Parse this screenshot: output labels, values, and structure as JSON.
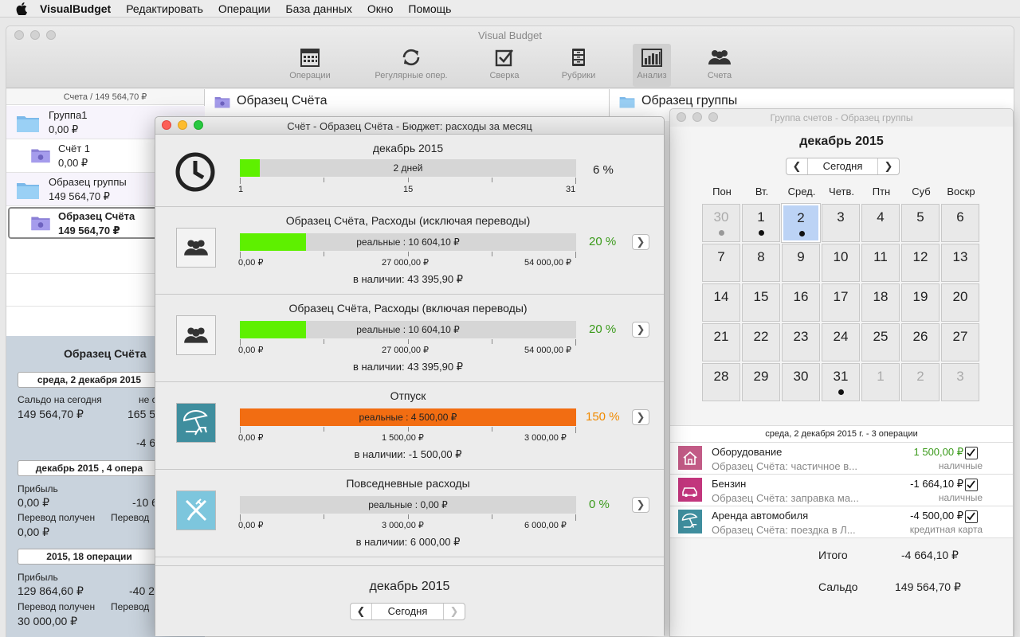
{
  "menubar": {
    "app": "VisualBudget",
    "items": [
      "Редактировать",
      "Операции",
      "База данных",
      "Окно",
      "Помощь"
    ]
  },
  "main_window": {
    "title": "Visual Budget",
    "toolbar": [
      {
        "label": "Операции",
        "icon": "calendar-icon"
      },
      {
        "label": "Регулярные опер.",
        "icon": "refresh-icon"
      },
      {
        "label": "Сверка",
        "icon": "checkbox-icon"
      },
      {
        "label": "Рубрики",
        "icon": "cabinet-icon"
      },
      {
        "label": "Анализ",
        "icon": "bar-chart-icon"
      },
      {
        "label": "Счета",
        "icon": "people-icon"
      }
    ]
  },
  "sidebar": {
    "header": "Счета / 149 564,70 ₽",
    "accounts": [
      {
        "name": "Группа1",
        "amount": "0,00 ₽"
      },
      {
        "name": "Счёт 1",
        "amount": "0,00 ₽"
      },
      {
        "name": "Образец группы",
        "amount": "149 564,70 ₽"
      },
      {
        "name": "Образец Счёта",
        "amount": "149 564,70 ₽"
      }
    ]
  },
  "info_panel": {
    "title": "Образец Счёта",
    "date_box": "среда, 2 декабря 2015",
    "saldo_label": "Сальдо на сегодня",
    "saldo_value": "149 564,70 ₽",
    "right_label_1": "не с",
    "right_value_1": "165 5",
    "right_value_2": "-4 6",
    "month_box": "декабрь 2015 , 4 опера",
    "profit_label": "Прибыль",
    "profit_value": "0,00 ₽",
    "profit_right": "-10 6",
    "transfer_in_label": "Перевод получен",
    "transfer_in_value": "0,00 ₽",
    "transfer_out_label": "Перевод",
    "year_box": "2015, 18 операции",
    "year_profit_label": "Прибыль",
    "year_profit_value": "129 864,60 ₽",
    "year_profit_right": "-40 2",
    "year_transfer_in_label": "Перевод получен",
    "year_transfer_in_value": "30 000,00 ₽",
    "year_transfer_out_label": "Перевод"
  },
  "mid_column": {
    "title": "Образец Счёта"
  },
  "right_column": {
    "title": "Образец группы"
  },
  "budget_window": {
    "title": "Счёт - Образец Счёта - Бюджет: расходы за месяц",
    "period": {
      "title": "декабрь 2015",
      "bar_label": "2 дней",
      "fill_fraction": 0.06,
      "percent": "6 %",
      "ticks": [
        "1",
        "15",
        "31"
      ],
      "bar_color": "#5ef000"
    },
    "budgets": [
      {
        "title": "Образец Счёта, Расходы  (исключая переводы)",
        "bar_label": "реальные : 10 604,10 ₽",
        "fill_fraction": 0.196,
        "percent": "20 %",
        "percent_color": "#3a9a1a",
        "bar_color": "#5ef000",
        "ticks": [
          "0,00 ₽",
          "27 000,00 ₽",
          "54 000,00 ₽"
        ],
        "available": "в наличии: 43 395,90 ₽",
        "icon": "people-icon"
      },
      {
        "title": "Образец Счёта, Расходы  (включая  переводы)",
        "bar_label": "реальные : 10 604,10 ₽",
        "fill_fraction": 0.196,
        "percent": "20 %",
        "percent_color": "#3a9a1a",
        "bar_color": "#5ef000",
        "ticks": [
          "0,00 ₽",
          "27 000,00 ₽",
          "54 000,00 ₽"
        ],
        "available": "в наличии: 43 395,90 ₽",
        "icon": "people-icon"
      },
      {
        "title": "Отпуск",
        "bar_label": "реальные : 4 500,00 ₽",
        "fill_fraction": 1.0,
        "percent": "150 %",
        "percent_color": "#f08a00",
        "bar_color": "#f26d12",
        "ticks": [
          "0,00 ₽",
          "1 500,00 ₽",
          "3 000,00 ₽"
        ],
        "available": "в наличии: -1 500,00 ₽",
        "icon": "beach-umbrella-icon"
      },
      {
        "title": "Повседневные расходы",
        "bar_label": "реальные : 0,00 ₽",
        "fill_fraction": 0.0,
        "percent": "0 %",
        "percent_color": "#3a9a1a",
        "bar_color": "#5ef000",
        "ticks": [
          "0,00 ₽",
          "3 000,00 ₽",
          "6 000,00 ₽"
        ],
        "available": "в наличии: 6 000,00 ₽",
        "icon": "fork-knife-icon"
      }
    ],
    "footer": {
      "month": "декабрь 2015",
      "today": "Сегодня"
    }
  },
  "calendar_window": {
    "title": "Группа счетов - Образец группы",
    "month": "декабрь 2015",
    "today": "Сегодня",
    "weekdays": [
      "Пон",
      "Вт.",
      "Сред.",
      "Четв.",
      "Птн",
      "Суб",
      "Воскр"
    ],
    "days": [
      {
        "d": "30",
        "dim": true,
        "dot": "grey"
      },
      {
        "d": "1",
        "dot": "black"
      },
      {
        "d": "2",
        "sel": true,
        "dot": "black"
      },
      {
        "d": "3"
      },
      {
        "d": "4"
      },
      {
        "d": "5"
      },
      {
        "d": "6"
      },
      {
        "d": "7"
      },
      {
        "d": "8"
      },
      {
        "d": "9"
      },
      {
        "d": "10"
      },
      {
        "d": "11"
      },
      {
        "d": "12"
      },
      {
        "d": "13"
      },
      {
        "d": "14"
      },
      {
        "d": "15"
      },
      {
        "d": "16"
      },
      {
        "d": "17"
      },
      {
        "d": "18"
      },
      {
        "d": "19"
      },
      {
        "d": "20"
      },
      {
        "d": "21"
      },
      {
        "d": "22"
      },
      {
        "d": "23"
      },
      {
        "d": "24"
      },
      {
        "d": "25"
      },
      {
        "d": "26"
      },
      {
        "d": "27"
      },
      {
        "d": "28"
      },
      {
        "d": "29"
      },
      {
        "d": "30"
      },
      {
        "d": "31",
        "dot": "black"
      },
      {
        "d": "1",
        "dim": true
      },
      {
        "d": "2",
        "dim": true
      },
      {
        "d": "3",
        "dim": true
      }
    ],
    "ops_header": "среда, 2 декабря 2015 г. - 3 операции",
    "transactions": [
      {
        "name": "Оборудование",
        "sub": "Образец Счёта: частичное в...",
        "amount": "1 500,00 ₽",
        "amount_color": "#3a9a1a",
        "account": "наличные",
        "icon": "house-icon",
        "icon_color": "#c25b86"
      },
      {
        "name": "Бензин",
        "sub": "Образец Счёта: заправка ма...",
        "amount": "-1 664,10 ₽",
        "amount_color": "#111",
        "account": "наличные",
        "icon": "car-icon",
        "icon_color": "#c2367d"
      },
      {
        "name": "Аренда автомобиля",
        "sub": "Образец Счёта: поездка в Л...",
        "amount": "-4 500,00 ₽",
        "amount_color": "#111",
        "account": "кредитная карта",
        "icon": "beach-umbrella-icon",
        "icon_color": "#3f8e9e"
      }
    ],
    "total_label": "Итого",
    "total_value": "-4 664,10 ₽",
    "saldo_label": "Сальдо",
    "saldo_value": "149 564,70 ₽"
  }
}
